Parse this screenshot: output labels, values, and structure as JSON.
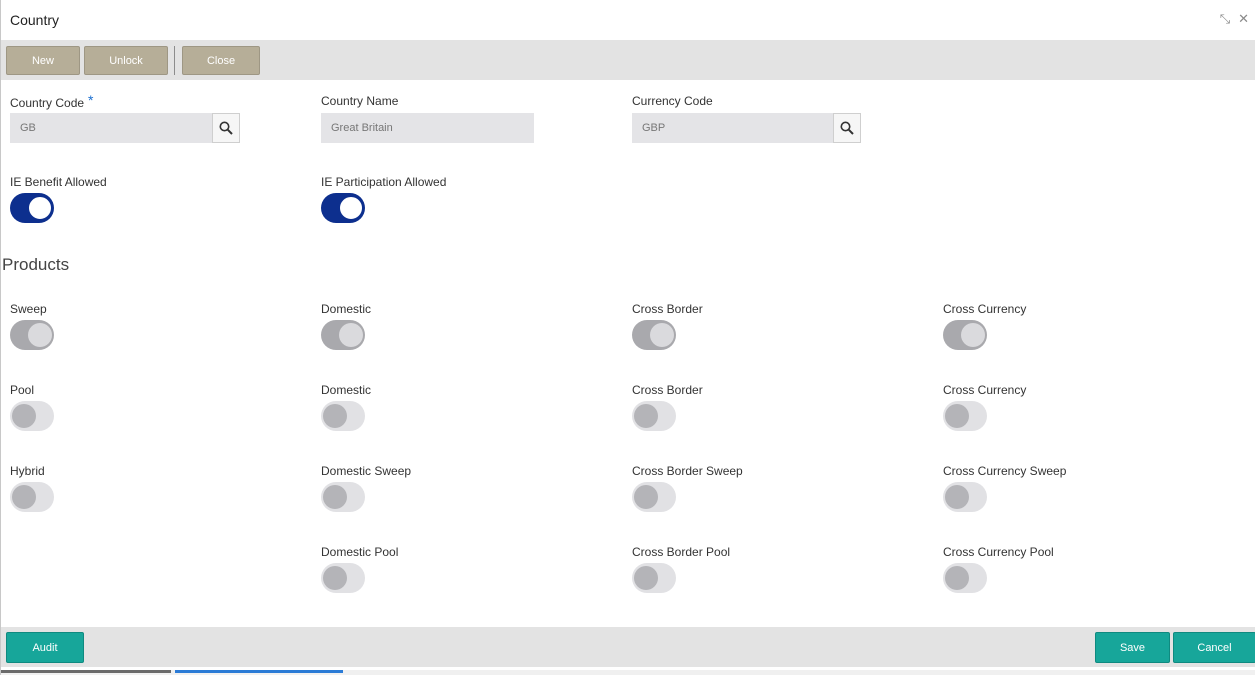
{
  "window": {
    "title": "Country",
    "minimize_glyph": "⤡",
    "close_glyph": "✕"
  },
  "toolbar": {
    "new_label": "New",
    "unlock_label": "Unlock",
    "close_label": "Close"
  },
  "fields": {
    "country_code": {
      "label": "Country Code",
      "required_mark": "*",
      "value": "GB"
    },
    "country_name": {
      "label": "Country Name",
      "value": "Great Britain"
    },
    "currency_code": {
      "label": "Currency Code",
      "value": "GBP"
    }
  },
  "flags": {
    "ie_benefit": {
      "label": "IE Benefit Allowed",
      "on": true
    },
    "ie_participation": {
      "label": "IE Participation Allowed",
      "on": true
    }
  },
  "products": {
    "heading": "Products",
    "sweep": {
      "label": "Sweep",
      "domestic": "Domestic",
      "cross_border": "Cross Border",
      "cross_currency": "Cross Currency",
      "state": "on-disabled"
    },
    "pool": {
      "label": "Pool",
      "domestic": "Domestic",
      "cross_border": "Cross Border",
      "cross_currency": "Cross Currency",
      "state": "off"
    },
    "hybrid": {
      "label": "Hybrid",
      "domestic_sweep": "Domestic Sweep",
      "cross_border_sweep": "Cross Border Sweep",
      "cross_currency_sweep": "Cross Currency Sweep",
      "domestic_pool": "Domestic Pool",
      "cross_border_pool": "Cross Border Pool",
      "cross_currency_pool": "Cross Currency Pool",
      "state": "off"
    }
  },
  "footer": {
    "audit_label": "Audit",
    "save_label": "Save",
    "cancel_label": "Cancel"
  },
  "colors": {
    "toggle_on": "#0d2f8e",
    "toolbar_button": "#b6ae98",
    "footer_button": "#17a69a"
  },
  "icons": {
    "lookup": "search-icon",
    "minimize": "minimize-icon",
    "close": "close-icon"
  }
}
